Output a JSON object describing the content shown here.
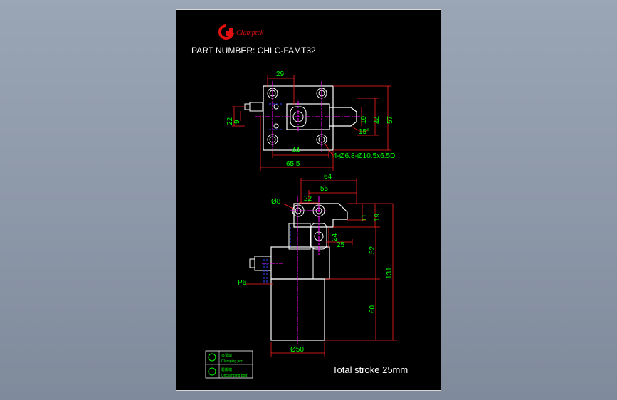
{
  "title_block": {
    "brand": "Clamptek",
    "part_label": "PART NUMBER: CHLC-FAMT32",
    "total_stroke": "Total stroke 25mm"
  },
  "top_view": {
    "dim_29": "29",
    "dim_22": "22",
    "dim_9": "9",
    "dim_19": "19",
    "dim_44_v": "44",
    "dim_57": "57",
    "dim_15deg": "15°",
    "dim_44_h": "44",
    "dim_65_5": "65.5",
    "hole_note": "4-Ø6.8-Ø10.5x6.5D"
  },
  "side_view": {
    "dim_64": "64",
    "dim_55": "55",
    "dim_22": "22",
    "dim_phi8": "Ø8",
    "dim_11": "11",
    "dim_19": "19",
    "dim_24": "24",
    "dim_25": "25",
    "dim_52": "52",
    "dim_131": "131",
    "dim_p6": "P6",
    "dim_60": "60",
    "dim_phi50": "Ø50"
  },
  "legend": {
    "item_a_title": "夾緊端",
    "item_a_sub": "Clamping port",
    "item_b_title": "鬆開端",
    "item_b_sub": "Unclamping port"
  },
  "colors": {
    "background": "#8f9aab",
    "sheet": "#000000",
    "outline": "#ffffff",
    "dimension_text": "#00ff00",
    "dimension_line": "#ff2020",
    "centerline": "#ff00ff",
    "hidden": "#3344ff",
    "brand_red": "#e01010"
  }
}
